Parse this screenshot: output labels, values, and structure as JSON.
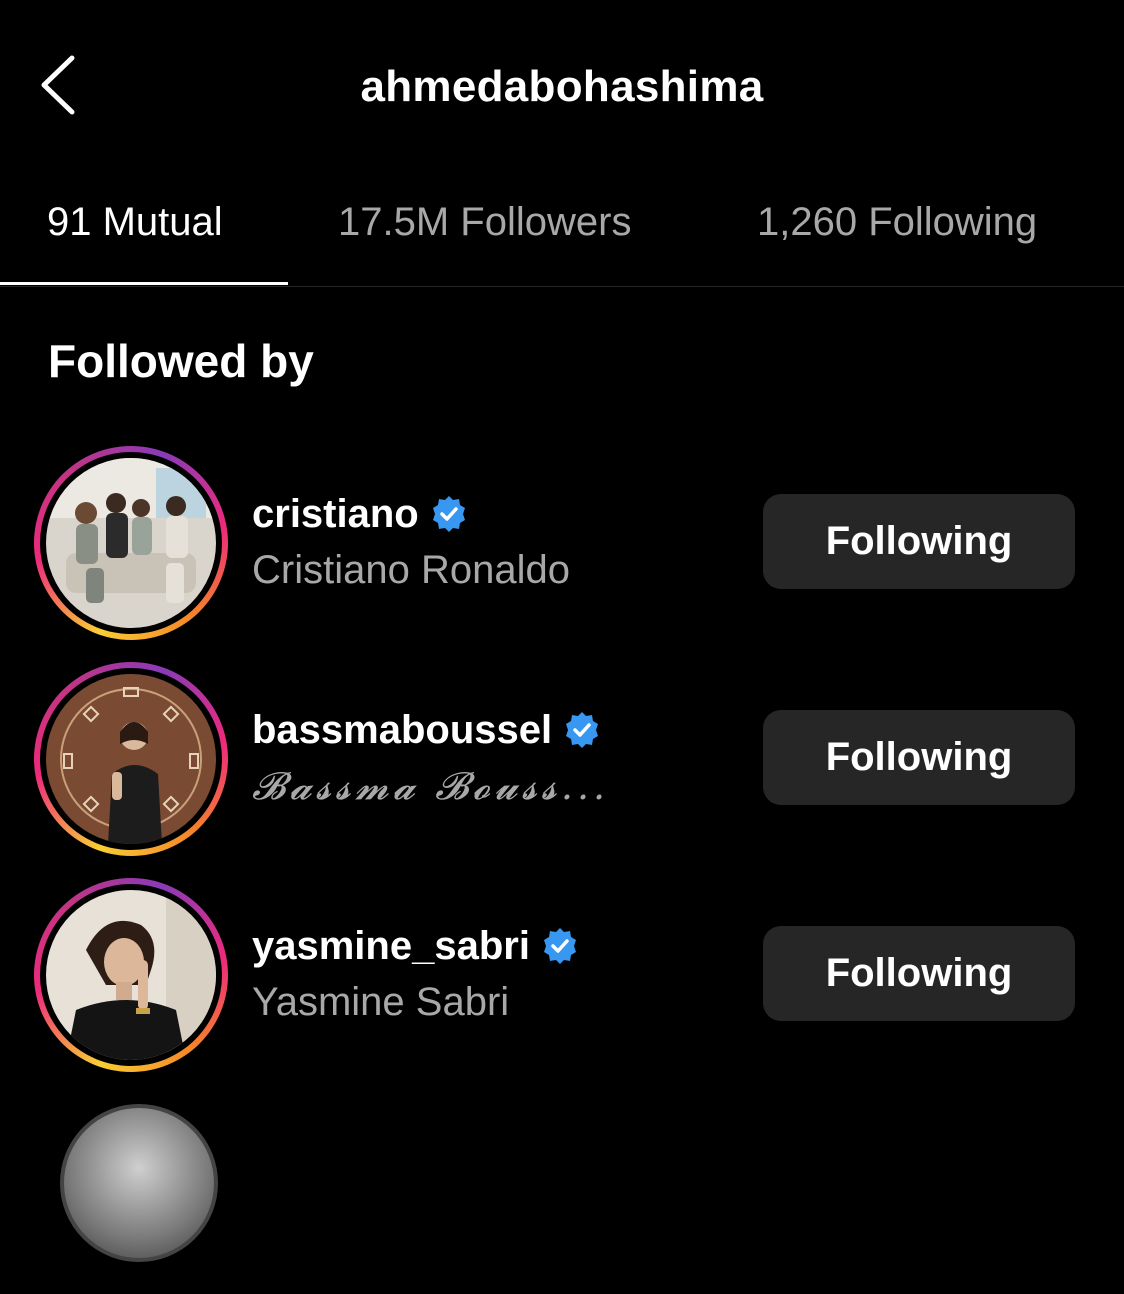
{
  "header": {
    "title": "ahmedabohashima",
    "back_icon": "chevron-left-icon"
  },
  "tabs": [
    {
      "label": "91 Mutual",
      "active": true
    },
    {
      "label": "17.5M Followers",
      "active": false
    },
    {
      "label": "1,260 Following",
      "active": false
    }
  ],
  "section": {
    "title": "Followed by"
  },
  "accounts": [
    {
      "username": "cristiano",
      "full_name": "Cristiano Ronaldo",
      "verified": true,
      "button_label": "Following"
    },
    {
      "username": "bassmaboussel",
      "full_name": "𝓑𝓪𝓼𝓼𝓶𝓪 𝓑𝓸𝓾𝓼𝓼...",
      "verified": true,
      "button_label": "Following"
    },
    {
      "username": "yasmine_sabri",
      "full_name": "Yasmine Sabri",
      "verified": true,
      "button_label": "Following"
    }
  ],
  "colors": {
    "background": "#000000",
    "button_bg": "#262626",
    "secondary_text": "#a8a8a8",
    "verified_blue": "#3897f0"
  }
}
